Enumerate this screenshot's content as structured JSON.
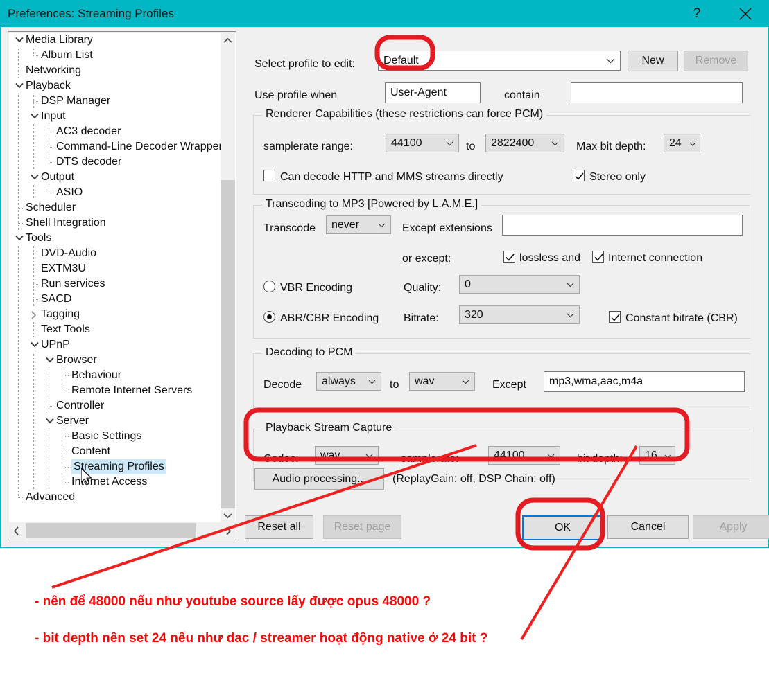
{
  "window": {
    "title": "Preferences: Streaming Profiles",
    "help_icon": "question-mark-icon",
    "close_icon": "close-x-icon",
    "accent_color": "#00b7c3"
  },
  "tree": {
    "items": [
      {
        "label": "Media Library",
        "depth": 0,
        "state": "expanded"
      },
      {
        "label": "Album List",
        "depth": 1,
        "state": "leaf-last"
      },
      {
        "label": "Networking",
        "depth": 0,
        "state": "leaf"
      },
      {
        "label": "Playback",
        "depth": 0,
        "state": "expanded"
      },
      {
        "label": "DSP Manager",
        "depth": 1,
        "state": "leaf"
      },
      {
        "label": "Input",
        "depth": 1,
        "state": "expanded"
      },
      {
        "label": "AC3 decoder",
        "depth": 2,
        "state": "leaf"
      },
      {
        "label": "Command-Line Decoder Wrapper",
        "depth": 2,
        "state": "leaf"
      },
      {
        "label": "DTS decoder",
        "depth": 2,
        "state": "leaf-last"
      },
      {
        "label": "Output",
        "depth": 1,
        "state": "expanded"
      },
      {
        "label": "ASIO",
        "depth": 2,
        "state": "leaf-last"
      },
      {
        "label": "Scheduler",
        "depth": 0,
        "state": "leaf"
      },
      {
        "label": "Shell Integration",
        "depth": 0,
        "state": "leaf"
      },
      {
        "label": "Tools",
        "depth": 0,
        "state": "expanded"
      },
      {
        "label": "DVD-Audio",
        "depth": 1,
        "state": "leaf"
      },
      {
        "label": "EXTM3U",
        "depth": 1,
        "state": "leaf"
      },
      {
        "label": "Run services",
        "depth": 1,
        "state": "leaf"
      },
      {
        "label": "SACD",
        "depth": 1,
        "state": "leaf"
      },
      {
        "label": "Tagging",
        "depth": 1,
        "state": "collapsed"
      },
      {
        "label": "Text Tools",
        "depth": 1,
        "state": "leaf"
      },
      {
        "label": "UPnP",
        "depth": 1,
        "state": "expanded"
      },
      {
        "label": "Browser",
        "depth": 2,
        "state": "expanded"
      },
      {
        "label": "Behaviour",
        "depth": 3,
        "state": "leaf"
      },
      {
        "label": "Remote Internet Servers",
        "depth": 3,
        "state": "leaf-last"
      },
      {
        "label": "Controller",
        "depth": 2,
        "state": "leaf"
      },
      {
        "label": "Server",
        "depth": 2,
        "state": "expanded"
      },
      {
        "label": "Basic Settings",
        "depth": 3,
        "state": "leaf"
      },
      {
        "label": "Content",
        "depth": 3,
        "state": "leaf"
      },
      {
        "label": "Streaming Profiles",
        "depth": 3,
        "state": "leaf",
        "selected": true
      },
      {
        "label": "Internet Access",
        "depth": 3,
        "state": "leaf-last"
      },
      {
        "label": "Advanced",
        "depth": 0,
        "state": "leaf-last"
      }
    ]
  },
  "profile": {
    "select_label": "Select profile to edit:",
    "selected": "Default",
    "new_button": "New",
    "remove_button": "Remove",
    "use_when_label": "Use profile when",
    "header_field": "User-Agent",
    "contain_label": "contain",
    "contain_value": ""
  },
  "renderer": {
    "group_title": "Renderer Capabilities (these restrictions can force PCM)",
    "samplerate_label": "samplerate range:",
    "samplerate_min": "44100",
    "to_label": "to",
    "samplerate_max": "2822400",
    "max_bit_depth_label": "Max bit depth:",
    "max_bit_depth": "24",
    "can_decode_label": "Can decode  HTTP and MMS  streams directly",
    "can_decode_checked": false,
    "stereo_only_label": "Stereo only",
    "stereo_only_checked": true
  },
  "transcoding": {
    "group_title": "Transcoding to MP3 [Powered by L.A.M.E.]",
    "transcode_label": "Transcode",
    "transcode_value": "never",
    "except_ext_label": "Except extensions",
    "except_ext_value": "",
    "or_except_label": "or except:",
    "lossless_label": "lossless and",
    "lossless_checked": true,
    "internet_label": "Internet connection",
    "internet_checked": true,
    "vbr_label": "VBR Encoding",
    "vbr_selected": false,
    "quality_label": "Quality:",
    "quality_value": "0",
    "abr_label": "ABR/CBR Encoding",
    "abr_selected": true,
    "bitrate_label": "Bitrate:",
    "bitrate_value": "320",
    "cbr_label": "Constant bitrate (CBR)",
    "cbr_checked": true
  },
  "decoding": {
    "group_title": "Decoding to PCM",
    "decode_label": "Decode",
    "decode_value": "always",
    "to_label": "to",
    "format_value": "wav",
    "except_label": "Except",
    "except_value": "mp3,wma,aac,m4a"
  },
  "capture": {
    "group_title": "Playback Stream Capture",
    "codec_label": "Codec:",
    "codec_value": "wav",
    "samplerate_label": "samplerate:",
    "samplerate_value": "44100",
    "bit_depth_label": "bit depth:",
    "bit_depth_value": "16"
  },
  "audio_processing": {
    "button_label": "Audio processing...",
    "status_text": "(ReplayGain: off, DSP Chain: off)"
  },
  "footer": {
    "reset_all": "Reset all",
    "reset_page": "Reset page",
    "ok": "OK",
    "cancel": "Cancel",
    "apply": "Apply"
  },
  "annotations": {
    "color": "#fb0606",
    "note1": "- nên để 48000 nếu như youtube source lấy được opus 48000 ?",
    "note2": "- bit depth nên set 24 nếu như dac / streamer hoạt động native ở 24 bit ?",
    "highlight_targets": [
      "profile-combo-default",
      "playback-stream-capture-group",
      "ok-button"
    ]
  }
}
